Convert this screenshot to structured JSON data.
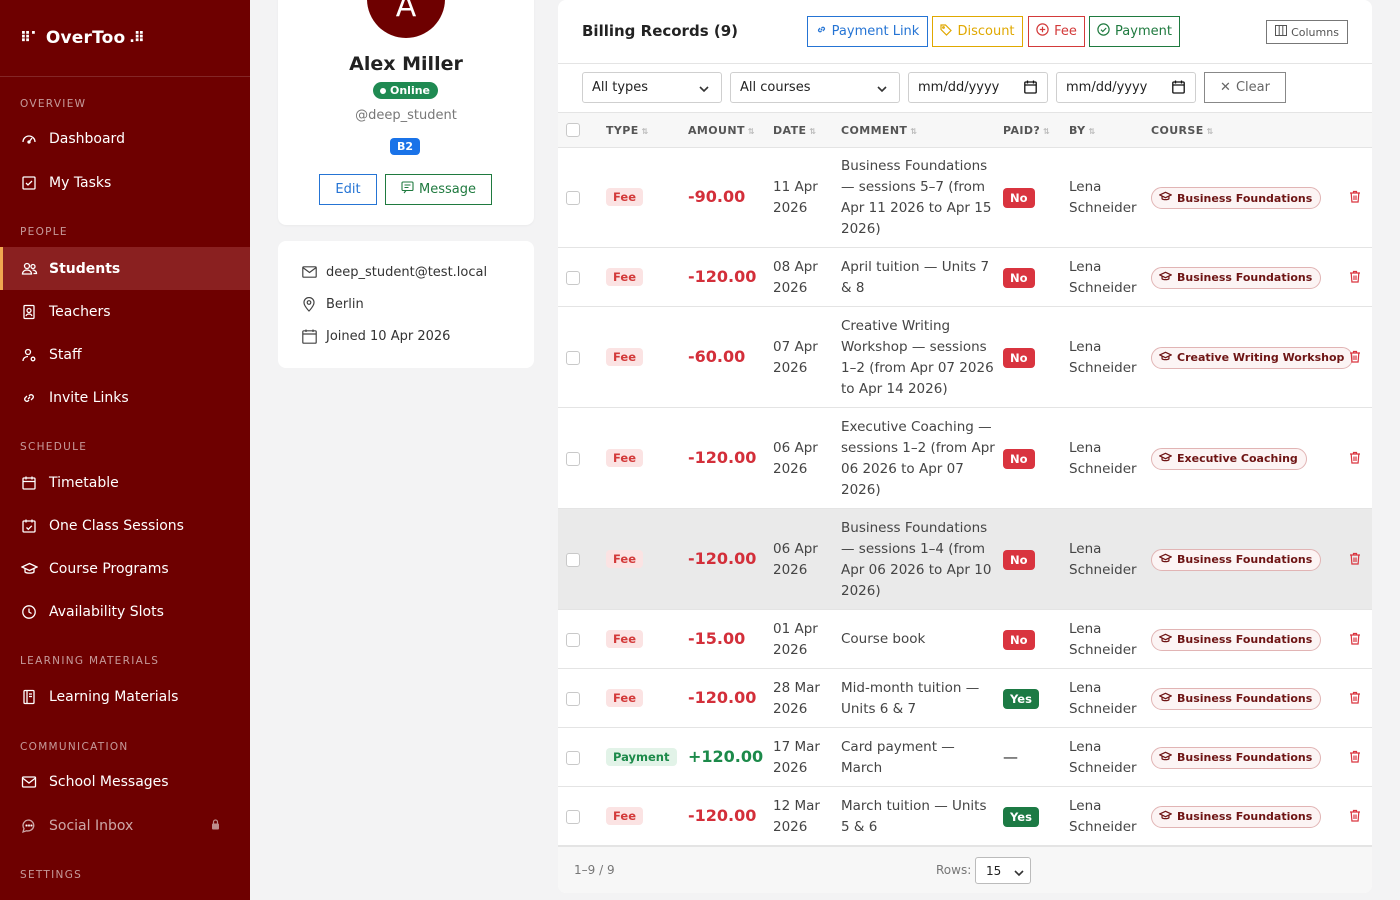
{
  "app": {
    "logo_text": "OverToo"
  },
  "sidebar": {
    "sections": {
      "overview": "OVERVIEW",
      "people": "PEOPLE",
      "schedule": "SCHEDULE",
      "learning": "LEARNING MATERIALS",
      "communication": "COMMUNICATION",
      "settings": "SETTINGS"
    },
    "items": {
      "dashboard": "Dashboard",
      "my_tasks": "My Tasks",
      "students": "Students",
      "teachers": "Teachers",
      "staff": "Staff",
      "invite_links": "Invite Links",
      "timetable": "Timetable",
      "one_class": "One Class Sessions",
      "course_programs": "Course Programs",
      "availability": "Availability Slots",
      "learning_materials": "Learning Materials",
      "school_messages": "School Messages",
      "social_inbox": "Social Inbox"
    },
    "active_item": "students"
  },
  "profile": {
    "avatar_initial": "A",
    "name": "Alex Miller",
    "status": "Online",
    "handle": "@deep_student",
    "level": "B2",
    "edit_label": "Edit",
    "message_label": "Message",
    "email": "deep_student@test.local",
    "city": "Berlin",
    "joined": "Joined 10 Apr 2026"
  },
  "billing": {
    "title": "Billing Records (9)",
    "actions": {
      "payment_link": "Payment Link",
      "discount": "Discount",
      "fee": "Fee",
      "payment": "Payment",
      "columns": "Columns"
    },
    "filters": {
      "type": "All types",
      "course": "All courses",
      "date_from": "mm/dd/yyyy",
      "date_to": "mm/dd/yyyy",
      "clear": "Clear"
    },
    "columns": {
      "type": "TYPE",
      "amount": "AMOUNT",
      "date": "DATE",
      "comment": "COMMENT",
      "paid": "PAID?",
      "by": "BY",
      "course": "COURSE"
    },
    "rows": [
      {
        "type": "Fee",
        "amount": "-90.00",
        "date_l1": "11 Apr",
        "date_l2": "2026",
        "comment": [
          "Business Foundations",
          "— sessions 5–7 (from",
          "Apr 11 2026 to Apr 15",
          "2026)"
        ],
        "paid": "No",
        "by_l1": "Lena",
        "by_l2": "Schneider",
        "course": "Business Foundations"
      },
      {
        "type": "Fee",
        "amount": "-120.00",
        "date_l1": "08 Apr",
        "date_l2": "2026",
        "comment": [
          "April tuition — Units 7",
          "& 8"
        ],
        "paid": "No",
        "by_l1": "Lena",
        "by_l2": "Schneider",
        "course": "Business Foundations"
      },
      {
        "type": "Fee",
        "amount": "-60.00",
        "date_l1": "07 Apr",
        "date_l2": "2026",
        "comment": [
          "Creative Writing",
          "Workshop — sessions",
          "1–2 (from Apr 07 2026",
          "to Apr 14 2026)"
        ],
        "paid": "No",
        "by_l1": "Lena",
        "by_l2": "Schneider",
        "course": "Creative Writing Workshop"
      },
      {
        "type": "Fee",
        "amount": "-120.00",
        "date_l1": "06 Apr",
        "date_l2": "2026",
        "comment": [
          "Executive Coaching —",
          "sessions 1–2 (from Apr",
          "06 2026 to Apr 07",
          "2026)"
        ],
        "paid": "No",
        "by_l1": "Lena",
        "by_l2": "Schneider",
        "course": "Executive Coaching"
      },
      {
        "type": "Fee",
        "amount": "-120.00",
        "date_l1": "06 Apr",
        "date_l2": "2026",
        "comment": [
          "Business Foundations",
          "— sessions 1–4 (from",
          "Apr 06 2026 to Apr 10",
          "2026)"
        ],
        "paid": "No",
        "by_l1": "Lena",
        "by_l2": "Schneider",
        "course": "Business Foundations",
        "highlighted": true
      },
      {
        "type": "Fee",
        "amount": "-15.00",
        "date_l1": "01 Apr",
        "date_l2": "2026",
        "comment": [
          "Course book"
        ],
        "paid": "No",
        "by_l1": "Lena",
        "by_l2": "Schneider",
        "course": "Business Foundations"
      },
      {
        "type": "Fee",
        "amount": "-120.00",
        "date_l1": "28 Mar",
        "date_l2": "2026",
        "comment": [
          "Mid-month tuition —",
          "Units 6 & 7"
        ],
        "paid": "Yes",
        "by_l1": "Lena",
        "by_l2": "Schneider",
        "course": "Business Foundations"
      },
      {
        "type": "Payment",
        "amount": "+120.00",
        "date_l1": "17 Mar",
        "date_l2": "2026",
        "comment": [
          "Card payment —",
          "March"
        ],
        "paid": "—",
        "by_l1": "Lena",
        "by_l2": "Schneider",
        "course": "Business Foundations"
      },
      {
        "type": "Fee",
        "amount": "-120.00",
        "date_l1": "12 Mar",
        "date_l2": "2026",
        "comment": [
          "March tuition — Units",
          "5 & 6"
        ],
        "paid": "Yes",
        "by_l1": "Lena",
        "by_l2": "Schneider",
        "course": "Business Foundations"
      }
    ],
    "footer": {
      "range": "1–9 / 9",
      "rows_label": "Rows:",
      "rows_value": "15"
    }
  },
  "colors": {
    "sidebar_bg": "#6e0000",
    "fee_red": "#d32f3a",
    "payment_green": "#1c8a4a",
    "link_blue": "#2574d4",
    "discount_amber": "#e0a800"
  }
}
